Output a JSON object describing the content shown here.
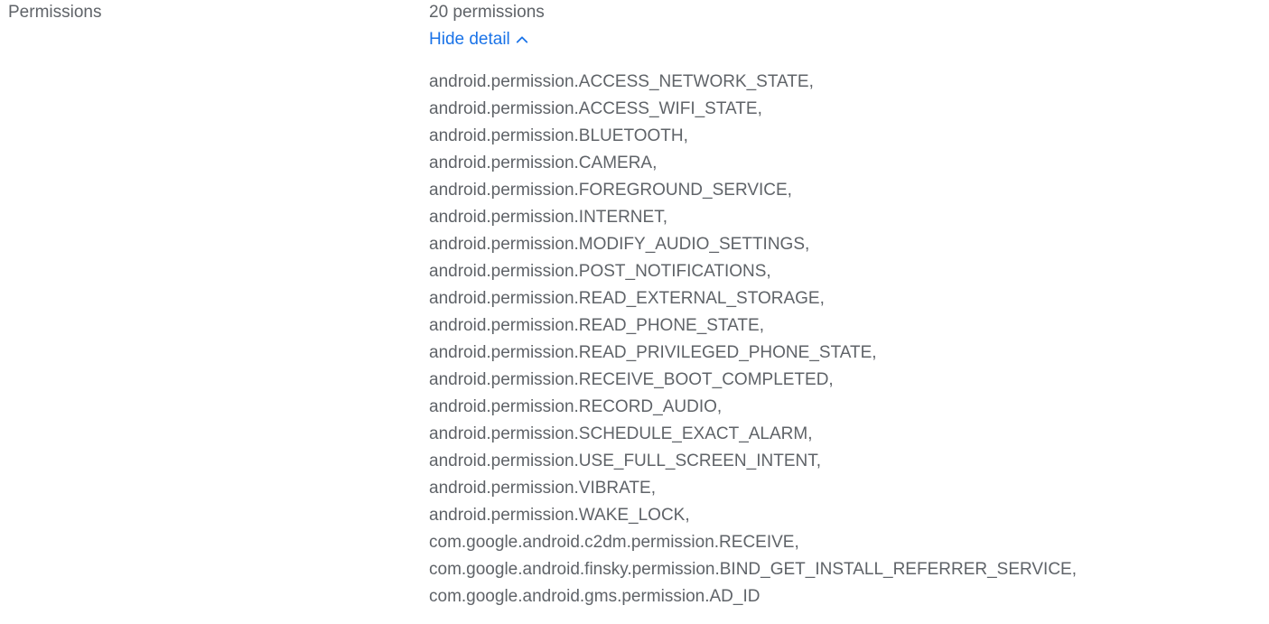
{
  "section": {
    "label": "Permissions",
    "count_text": "20 permissions",
    "toggle_label": "Hide detail",
    "toggle_icon": "chevron-up-icon",
    "accent_color": "#1a73e8",
    "text_color": "#5f6368"
  },
  "permissions": [
    "android.permission.ACCESS_NETWORK_STATE,",
    "android.permission.ACCESS_WIFI_STATE,",
    "android.permission.BLUETOOTH,",
    "android.permission.CAMERA,",
    "android.permission.FOREGROUND_SERVICE,",
    "android.permission.INTERNET,",
    "android.permission.MODIFY_AUDIO_SETTINGS,",
    "android.permission.POST_NOTIFICATIONS,",
    "android.permission.READ_EXTERNAL_STORAGE,",
    "android.permission.READ_PHONE_STATE,",
    "android.permission.READ_PRIVILEGED_PHONE_STATE,",
    "android.permission.RECEIVE_BOOT_COMPLETED,",
    "android.permission.RECORD_AUDIO,",
    "android.permission.SCHEDULE_EXACT_ALARM,",
    "android.permission.USE_FULL_SCREEN_INTENT,",
    "android.permission.VIBRATE,",
    "android.permission.WAKE_LOCK,",
    "com.google.android.c2dm.permission.RECEIVE,",
    "com.google.android.finsky.permission.BIND_GET_INSTALL_REFERRER_SERVICE,",
    "com.google.android.gms.permission.AD_ID"
  ]
}
